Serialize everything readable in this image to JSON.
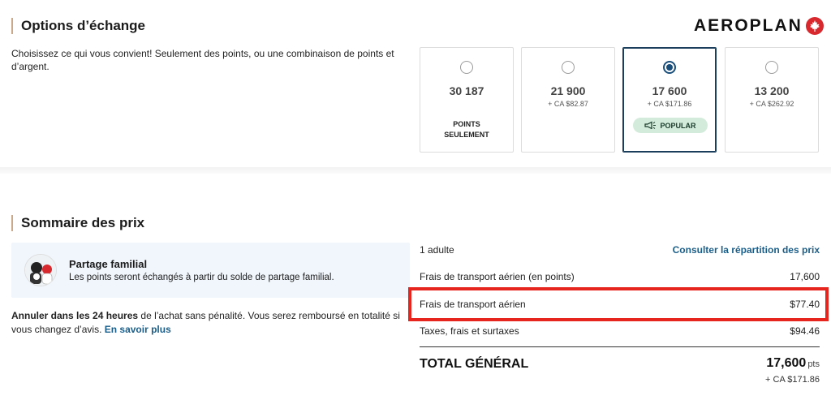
{
  "exchange": {
    "title": "Options d’échange",
    "intro": "Choisissez ce qui vous convient! Seulement des points, ou une combinaison de points et d’argent.",
    "brand": "AEROPLAN",
    "options": [
      {
        "points": "30 187",
        "cash": "",
        "label_line1": "POINTS",
        "label_line2": "SEULEMENT",
        "selected": false
      },
      {
        "points": "21 900",
        "cash": "+ CA $82.87",
        "selected": false
      },
      {
        "points": "17 600",
        "cash": "+ CA $171.86",
        "badge": "POPULAR",
        "selected": true
      },
      {
        "points": "13 200",
        "cash": "+ CA $262.92",
        "selected": false
      }
    ]
  },
  "summary": {
    "title": "Sommaire des prix",
    "family": {
      "title": "Partage familial",
      "desc": "Les points seront échangés à partir du solde de partage familial."
    },
    "cancel": {
      "bold": "Annuler dans les 24 heures",
      "text": " de l’achat sans pénalité. Vous serez remboursé en totalité si vous changez d’avis. ",
      "link": "En savoir plus"
    },
    "adults": "1 adulte",
    "breakdown_link": "Consulter la répartition des prix",
    "lines": [
      {
        "label": "Frais de transport aérien (en points)",
        "value": "17,600"
      },
      {
        "label": "Frais de transport aérien",
        "value": "$77.40"
      },
      {
        "label": "Taxes, frais et surtaxes",
        "value": "$94.46"
      }
    ],
    "total": {
      "label": "TOTAL GÉNÉRAL",
      "points": "17,600",
      "unit": "pts",
      "cash": "+ CA $171.86"
    }
  },
  "colors": {
    "accent": "#1a4e7a",
    "highlight": "#e5251e",
    "badge_bg": "#d3ebdb"
  }
}
